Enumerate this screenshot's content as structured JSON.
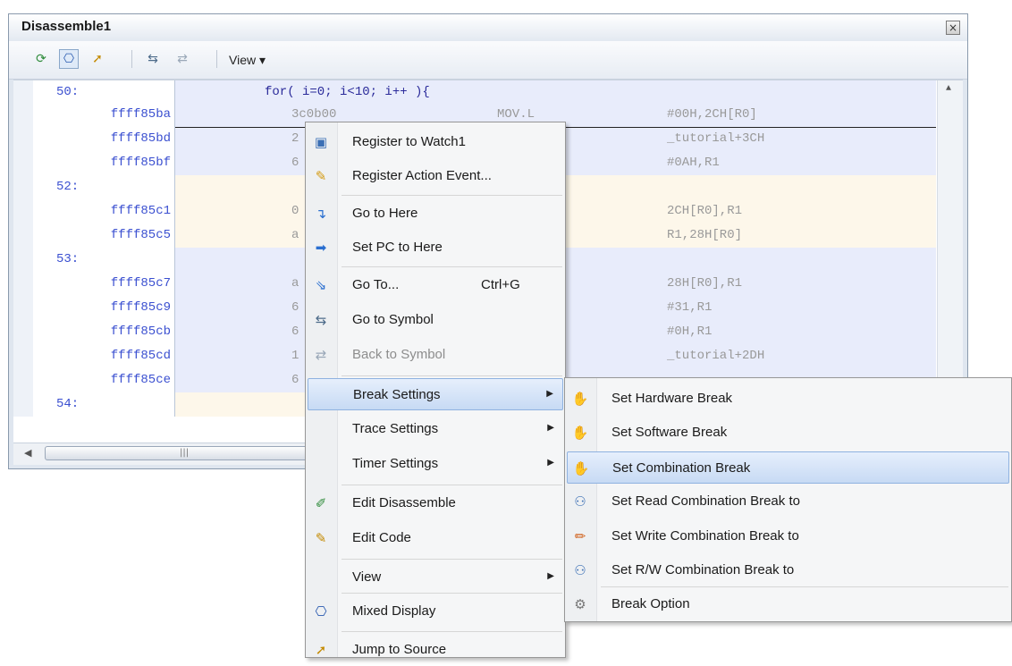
{
  "window": {
    "title": "Disassemble1",
    "close_glyph": "×"
  },
  "toolbar": {
    "buttons": [
      {
        "icon": "refresh-icon",
        "glyph": "⟳",
        "color": "#2e8b3a"
      },
      {
        "icon": "mixed-display-icon",
        "glyph": "⎔",
        "color": "#2a5ab0"
      },
      {
        "icon": "jump-to-source-icon",
        "glyph": "➚",
        "color": "#c48a00"
      },
      {
        "icon": "go-to-symbol-icon",
        "glyph": "⇆",
        "color": "#4d6b8a"
      },
      {
        "icon": "back-to-symbol-icon",
        "glyph": "⇄",
        "color": "#9aa8b8"
      }
    ],
    "view_label": "View ▾"
  },
  "code_rows": [
    {
      "kind": "src",
      "label": "50:",
      "stmt": "for( i=0; i<10; i++ ){",
      "shade": "blue"
    },
    {
      "kind": "asm",
      "addr": "ffff85ba",
      "bytes": "3c0b00",
      "mnem": "MOV.L",
      "oper": "#00H,2CH[R0]",
      "shade": "blue"
    },
    {
      "kind": "asm",
      "addr": "ffff85bd",
      "bytes": "2",
      "mnem": "",
      "oper": "_tutorial+3CH",
      "shade": "blue"
    },
    {
      "kind": "asm",
      "addr": "ffff85bf",
      "bytes": "6",
      "mnem": "",
      "oper": "#0AH,R1",
      "shade": "blue"
    },
    {
      "kind": "src",
      "label": "52:",
      "stmt": "",
      "shade": "cream"
    },
    {
      "kind": "asm",
      "addr": "ffff85c1",
      "bytes": "0",
      "mnem": "",
      "oper": "2CH[R0],R1",
      "shade": "cream"
    },
    {
      "kind": "asm",
      "addr": "ffff85c5",
      "bytes": "a",
      "mnem": "",
      "oper": "R1,28H[R0]",
      "shade": "cream"
    },
    {
      "kind": "src",
      "label": "53:",
      "stmt": "",
      "shade": "blue"
    },
    {
      "kind": "asm",
      "addr": "ffff85c7",
      "bytes": "a",
      "mnem": "",
      "oper": "28H[R0],R1",
      "shade": "blue"
    },
    {
      "kind": "asm",
      "addr": "ffff85c9",
      "bytes": "6",
      "mnem": "",
      "oper": "#31,R1",
      "shade": "blue"
    },
    {
      "kind": "asm",
      "addr": "ffff85cb",
      "bytes": "6",
      "mnem": "",
      "oper": "#0H,R1",
      "shade": "blue"
    },
    {
      "kind": "asm",
      "addr": "ffff85cd",
      "bytes": "1",
      "mnem": "",
      "oper": "_tutorial+2DH",
      "shade": "blue"
    },
    {
      "kind": "asm",
      "addr": "ffff85ce",
      "bytes": "6",
      "mnem": "",
      "oper": "",
      "shade": "blue"
    },
    {
      "kind": "src",
      "label": "54:",
      "stmt": "",
      "shade": "cream"
    }
  ],
  "context_menu": {
    "items": [
      {
        "id": "register-to-watch1",
        "label": "Register to Watch1",
        "icon": "watch-icon",
        "glyph": "▣",
        "color": "#3b6fb5"
      },
      {
        "id": "register-action-event",
        "label": "Register Action Event...",
        "icon": "action-event-icon",
        "glyph": "✎",
        "color": "#d49a10",
        "sep_after": true
      },
      {
        "id": "go-to-here",
        "label": "Go to Here",
        "icon": "go-to-here-icon",
        "glyph": "↴",
        "color": "#2a6fd0"
      },
      {
        "id": "set-pc-to-here",
        "label": "Set PC to Here",
        "icon": "set-pc-icon",
        "glyph": "➡",
        "color": "#2a6fd0",
        "sep_after": true
      },
      {
        "id": "go-to",
        "label": "Go To...",
        "shortcut": "Ctrl+G",
        "icon": "go-to-icon",
        "glyph": "⇘",
        "color": "#2a6fd0"
      },
      {
        "id": "go-to-symbol",
        "label": "Go to Symbol",
        "icon": "go-to-symbol-icon",
        "glyph": "⇆",
        "color": "#4d6b8a"
      },
      {
        "id": "back-to-symbol",
        "label": "Back to Symbol",
        "icon": "back-to-symbol-icon",
        "glyph": "⇄",
        "color": "#9aa8b8",
        "disabled": true,
        "sep_after": true
      },
      {
        "id": "break-settings",
        "label": "Break Settings",
        "submenu": true,
        "highlighted": true
      },
      {
        "id": "trace-settings",
        "label": "Trace Settings",
        "submenu": true
      },
      {
        "id": "timer-settings",
        "label": "Timer Settings",
        "submenu": true,
        "sep_after": true
      },
      {
        "id": "edit-disassemble",
        "label": "Edit Disassemble",
        "icon": "edit-disassemble-icon",
        "glyph": "✐",
        "color": "#2e8b3a"
      },
      {
        "id": "edit-code",
        "label": "Edit Code",
        "icon": "edit-code-icon",
        "glyph": "✎",
        "color": "#c48a00",
        "sep_after": true
      },
      {
        "id": "view",
        "label": "View",
        "submenu": true,
        "sep_after": true
      },
      {
        "id": "mixed-display",
        "label": "Mixed Display",
        "icon": "mixed-display-icon",
        "glyph": "⎔",
        "color": "#2a5ab0",
        "sep_after": true
      },
      {
        "id": "jump-to-source",
        "label": "Jump to Source",
        "icon": "jump-to-source-icon",
        "glyph": "➚",
        "color": "#c48a00"
      }
    ]
  },
  "break_submenu": {
    "items": [
      {
        "id": "set-hardware-break",
        "label": "Set Hardware Break",
        "icon": "hardware-break-icon",
        "glyph": "✋",
        "color": "#2e8b3a"
      },
      {
        "id": "set-software-break",
        "label": "Set Software Break",
        "icon": "software-break-icon",
        "glyph": "✋",
        "color": "#c07a3a"
      },
      {
        "id": "set-combination-break",
        "label": "Set Combination Break",
        "icon": "combination-break-icon",
        "glyph": "✋",
        "color": "#2e8b3a",
        "highlighted": true
      },
      {
        "id": "set-read-combination-break",
        "label": "Set Read Combination Break to",
        "icon": "read-combination-icon",
        "glyph": "⚇",
        "color": "#3b6fb5"
      },
      {
        "id": "set-write-combination-break",
        "label": "Set Write Combination Break to",
        "icon": "write-combination-icon",
        "glyph": "✏",
        "color": "#d0601a"
      },
      {
        "id": "set-rw-combination-break",
        "label": "Set R/W Combination Break to",
        "icon": "rw-combination-icon",
        "glyph": "⚇",
        "color": "#3b6fb5",
        "sep_after": true
      },
      {
        "id": "break-option",
        "label": "Break Option",
        "icon": "break-option-icon",
        "glyph": "⚙",
        "color": "#777777"
      }
    ]
  },
  "scrollbar": {
    "up_arrow": "▲",
    "left_arrow": "◀",
    "grip": "|||"
  }
}
